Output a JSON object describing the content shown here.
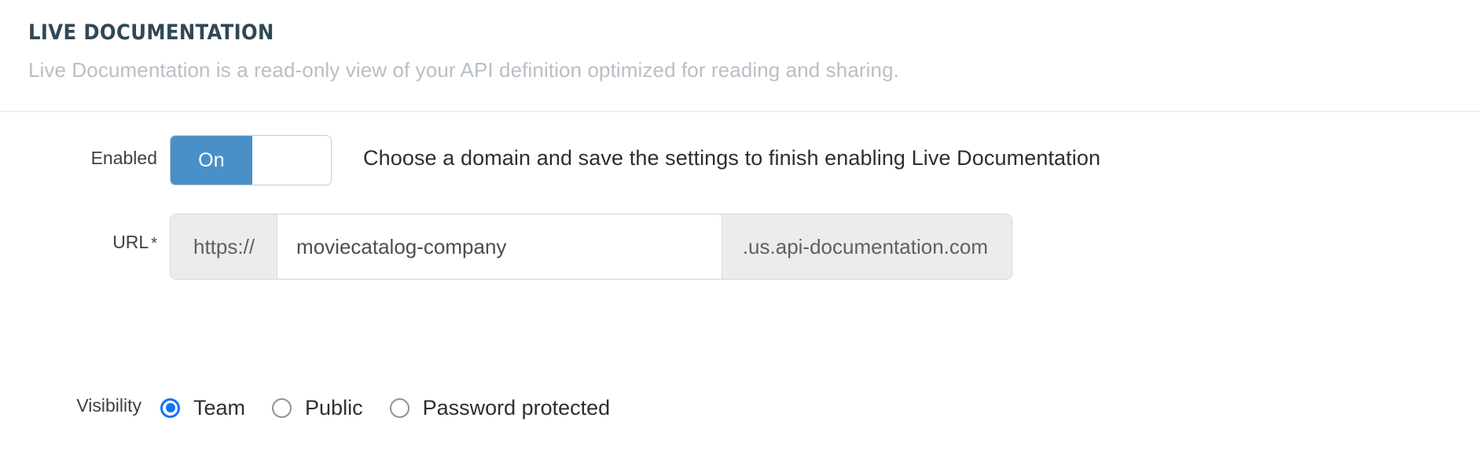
{
  "header": {
    "title": "LIVE DOCUMENTATION",
    "subtitle": "Live Documentation is a read-only view of your API definition optimized for reading and sharing."
  },
  "enabled": {
    "label": "Enabled",
    "toggle_on_label": "On",
    "toggle_state": "On",
    "hint": "Choose a domain and save the settings to finish enabling Live Documentation"
  },
  "url": {
    "label": "URL",
    "required_marker": "*",
    "prefix": "https://",
    "value": "moviecatalog-company",
    "placeholder": "",
    "suffix": ".us.api-documentation.com"
  },
  "visibility": {
    "label": "Visibility",
    "selected": "Team",
    "options": [
      {
        "label": "Team",
        "checked": true
      },
      {
        "label": "Public",
        "checked": false
      },
      {
        "label": "Password protected",
        "checked": false
      }
    ]
  },
  "colors": {
    "title": "#2f4858",
    "subtitle": "#b9bfc4",
    "toggle_on": "#4a90c8",
    "radio_accent": "#1074f0",
    "addon_bg": "#ececec",
    "border": "#d3d6d9"
  }
}
